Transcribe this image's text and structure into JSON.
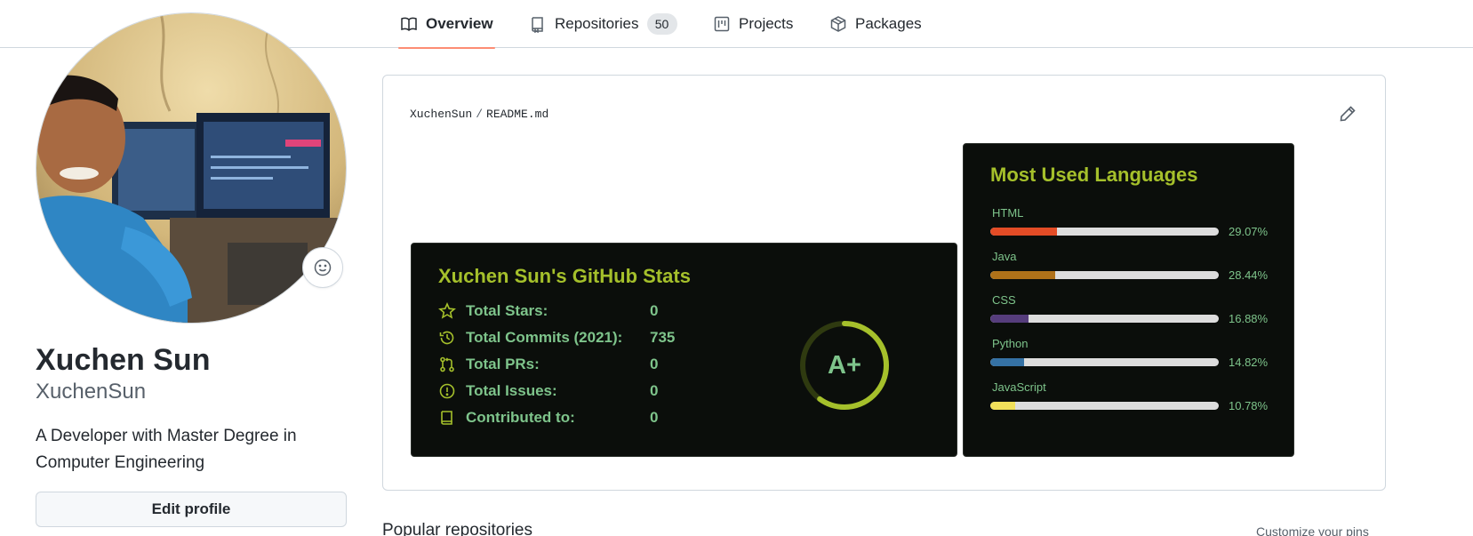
{
  "nav": {
    "tabs": [
      {
        "label": "Overview",
        "icon": "book-icon",
        "active": true
      },
      {
        "label": "Repositories",
        "icon": "repo-icon",
        "count": "50"
      },
      {
        "label": "Projects",
        "icon": "project-icon"
      },
      {
        "label": "Packages",
        "icon": "package-icon"
      }
    ]
  },
  "profile": {
    "name": "Xuchen Sun",
    "username": "XuchenSun",
    "bio": "A Developer with Master Degree in Computer Engineering",
    "edit_label": "Edit profile",
    "avatar_icon": "profile-photo",
    "status_icon": "smiley-icon"
  },
  "readme": {
    "owner": "XuchenSun",
    "separator": "/",
    "file": "README.md",
    "edit_icon": "pencil-icon"
  },
  "stats_card": {
    "title": "Xuchen Sun's GitHub Stats",
    "rows": [
      {
        "icon": "star-icon",
        "label": "Total Stars:",
        "value": "0"
      },
      {
        "icon": "history-icon",
        "label": "Total Commits (2021):",
        "value": "735"
      },
      {
        "icon": "pull-request-icon",
        "label": "Total PRs:",
        "value": "0"
      },
      {
        "icon": "issue-icon",
        "label": "Total Issues:",
        "value": "0"
      },
      {
        "icon": "repo-icon",
        "label": "Contributed to:",
        "value": "0"
      }
    ],
    "rank": "A+",
    "rank_progress": 0.6,
    "colors": {
      "background": "#0b0e0b",
      "title": "#a5c02b",
      "text": "#7ec48b",
      "ring": "#a5c02b"
    }
  },
  "languages_card": {
    "title": "Most Used Languages",
    "items": [
      {
        "name": "HTML",
        "percent": "29.07%",
        "value": 29.07,
        "color": "#e34c26"
      },
      {
        "name": "Java",
        "percent": "28.44%",
        "value": 28.44,
        "color": "#b07219"
      },
      {
        "name": "CSS",
        "percent": "16.88%",
        "value": 16.88,
        "color": "#563d7c"
      },
      {
        "name": "Python",
        "percent": "14.82%",
        "value": 14.82,
        "color": "#3572a5"
      },
      {
        "name": "JavaScript",
        "percent": "10.78%",
        "value": 10.78,
        "color": "#f1e05a"
      }
    ]
  },
  "footer": {
    "popular": "Popular repositories",
    "customize": "Customize your pins"
  }
}
